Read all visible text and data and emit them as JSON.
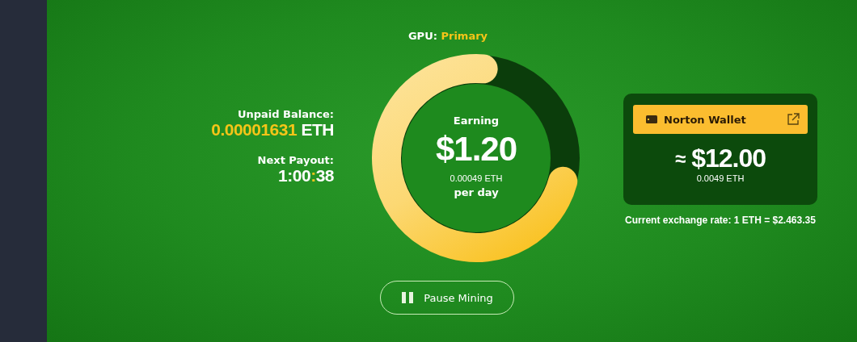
{
  "gpu": {
    "label": "GPU:",
    "value": "Primary"
  },
  "balance": {
    "label": "Unpaid Balance:",
    "amount": "0.00001631",
    "unit": "ETH"
  },
  "payout": {
    "label": "Next Payout:",
    "hours_minutes": "1:00",
    "separator": ":",
    "seconds": "38"
  },
  "earning": {
    "label": "Earning",
    "amount": "$1.20",
    "eth": "0.00049 ETH",
    "period": "per day",
    "level": 0.72
  },
  "wallet": {
    "name": "Norton Wallet",
    "approx": "≈",
    "amount": "$12.00",
    "eth": "0.0049 ETH"
  },
  "exchange_rate": "Current exchange rate: 1 ETH = $2.463.35",
  "button": {
    "label": "Pause Mining"
  }
}
